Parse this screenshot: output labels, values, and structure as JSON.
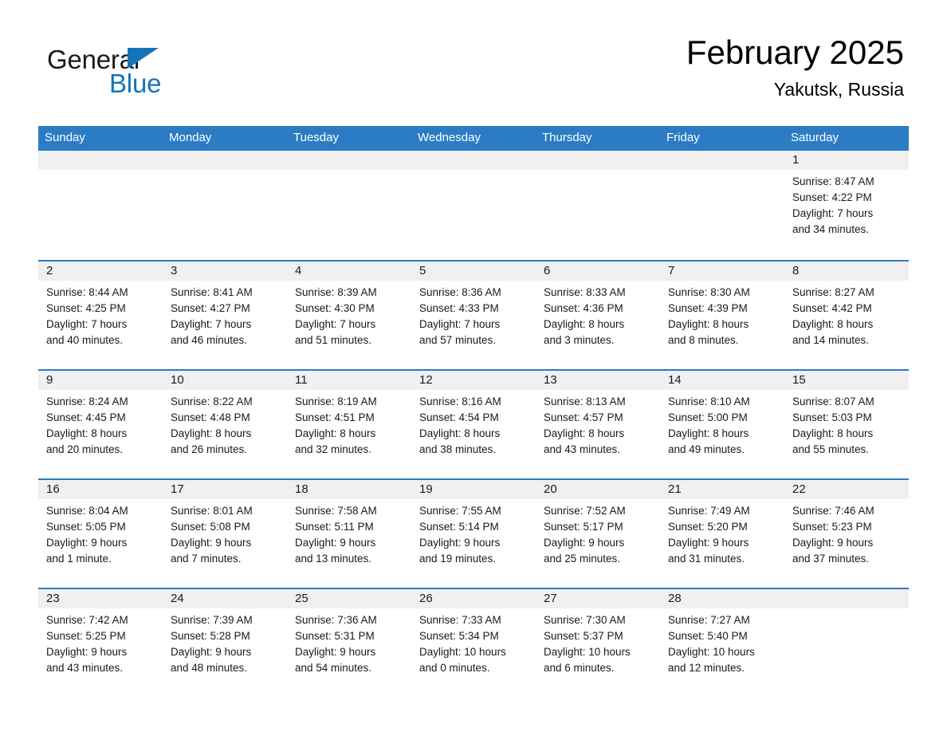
{
  "logo": {
    "word1": "General",
    "word2": "Blue",
    "triangle_color": "#1573b9",
    "text_color": "#1a1a1a"
  },
  "header": {
    "title": "February 2025",
    "location": "Yakutsk, Russia",
    "accent_color": "#2b7cc4"
  },
  "weekdays": [
    "Sunday",
    "Monday",
    "Tuesday",
    "Wednesday",
    "Thursday",
    "Friday",
    "Saturday"
  ],
  "weeks": [
    {
      "days": [
        {
          "num": "",
          "sunrise": "",
          "sunset": "",
          "daylight1": "",
          "daylight2": ""
        },
        {
          "num": "",
          "sunrise": "",
          "sunset": "",
          "daylight1": "",
          "daylight2": ""
        },
        {
          "num": "",
          "sunrise": "",
          "sunset": "",
          "daylight1": "",
          "daylight2": ""
        },
        {
          "num": "",
          "sunrise": "",
          "sunset": "",
          "daylight1": "",
          "daylight2": ""
        },
        {
          "num": "",
          "sunrise": "",
          "sunset": "",
          "daylight1": "",
          "daylight2": ""
        },
        {
          "num": "",
          "sunrise": "",
          "sunset": "",
          "daylight1": "",
          "daylight2": ""
        },
        {
          "num": "1",
          "sunrise": "Sunrise: 8:47 AM",
          "sunset": "Sunset: 4:22 PM",
          "daylight1": "Daylight: 7 hours",
          "daylight2": "and 34 minutes."
        }
      ]
    },
    {
      "days": [
        {
          "num": "2",
          "sunrise": "Sunrise: 8:44 AM",
          "sunset": "Sunset: 4:25 PM",
          "daylight1": "Daylight: 7 hours",
          "daylight2": "and 40 minutes."
        },
        {
          "num": "3",
          "sunrise": "Sunrise: 8:41 AM",
          "sunset": "Sunset: 4:27 PM",
          "daylight1": "Daylight: 7 hours",
          "daylight2": "and 46 minutes."
        },
        {
          "num": "4",
          "sunrise": "Sunrise: 8:39 AM",
          "sunset": "Sunset: 4:30 PM",
          "daylight1": "Daylight: 7 hours",
          "daylight2": "and 51 minutes."
        },
        {
          "num": "5",
          "sunrise": "Sunrise: 8:36 AM",
          "sunset": "Sunset: 4:33 PM",
          "daylight1": "Daylight: 7 hours",
          "daylight2": "and 57 minutes."
        },
        {
          "num": "6",
          "sunrise": "Sunrise: 8:33 AM",
          "sunset": "Sunset: 4:36 PM",
          "daylight1": "Daylight: 8 hours",
          "daylight2": "and 3 minutes."
        },
        {
          "num": "7",
          "sunrise": "Sunrise: 8:30 AM",
          "sunset": "Sunset: 4:39 PM",
          "daylight1": "Daylight: 8 hours",
          "daylight2": "and 8 minutes."
        },
        {
          "num": "8",
          "sunrise": "Sunrise: 8:27 AM",
          "sunset": "Sunset: 4:42 PM",
          "daylight1": "Daylight: 8 hours",
          "daylight2": "and 14 minutes."
        }
      ]
    },
    {
      "days": [
        {
          "num": "9",
          "sunrise": "Sunrise: 8:24 AM",
          "sunset": "Sunset: 4:45 PM",
          "daylight1": "Daylight: 8 hours",
          "daylight2": "and 20 minutes."
        },
        {
          "num": "10",
          "sunrise": "Sunrise: 8:22 AM",
          "sunset": "Sunset: 4:48 PM",
          "daylight1": "Daylight: 8 hours",
          "daylight2": "and 26 minutes."
        },
        {
          "num": "11",
          "sunrise": "Sunrise: 8:19 AM",
          "sunset": "Sunset: 4:51 PM",
          "daylight1": "Daylight: 8 hours",
          "daylight2": "and 32 minutes."
        },
        {
          "num": "12",
          "sunrise": "Sunrise: 8:16 AM",
          "sunset": "Sunset: 4:54 PM",
          "daylight1": "Daylight: 8 hours",
          "daylight2": "and 38 minutes."
        },
        {
          "num": "13",
          "sunrise": "Sunrise: 8:13 AM",
          "sunset": "Sunset: 4:57 PM",
          "daylight1": "Daylight: 8 hours",
          "daylight2": "and 43 minutes."
        },
        {
          "num": "14",
          "sunrise": "Sunrise: 8:10 AM",
          "sunset": "Sunset: 5:00 PM",
          "daylight1": "Daylight: 8 hours",
          "daylight2": "and 49 minutes."
        },
        {
          "num": "15",
          "sunrise": "Sunrise: 8:07 AM",
          "sunset": "Sunset: 5:03 PM",
          "daylight1": "Daylight: 8 hours",
          "daylight2": "and 55 minutes."
        }
      ]
    },
    {
      "days": [
        {
          "num": "16",
          "sunrise": "Sunrise: 8:04 AM",
          "sunset": "Sunset: 5:05 PM",
          "daylight1": "Daylight: 9 hours",
          "daylight2": "and 1 minute."
        },
        {
          "num": "17",
          "sunrise": "Sunrise: 8:01 AM",
          "sunset": "Sunset: 5:08 PM",
          "daylight1": "Daylight: 9 hours",
          "daylight2": "and 7 minutes."
        },
        {
          "num": "18",
          "sunrise": "Sunrise: 7:58 AM",
          "sunset": "Sunset: 5:11 PM",
          "daylight1": "Daylight: 9 hours",
          "daylight2": "and 13 minutes."
        },
        {
          "num": "19",
          "sunrise": "Sunrise: 7:55 AM",
          "sunset": "Sunset: 5:14 PM",
          "daylight1": "Daylight: 9 hours",
          "daylight2": "and 19 minutes."
        },
        {
          "num": "20",
          "sunrise": "Sunrise: 7:52 AM",
          "sunset": "Sunset: 5:17 PM",
          "daylight1": "Daylight: 9 hours",
          "daylight2": "and 25 minutes."
        },
        {
          "num": "21",
          "sunrise": "Sunrise: 7:49 AM",
          "sunset": "Sunset: 5:20 PM",
          "daylight1": "Daylight: 9 hours",
          "daylight2": "and 31 minutes."
        },
        {
          "num": "22",
          "sunrise": "Sunrise: 7:46 AM",
          "sunset": "Sunset: 5:23 PM",
          "daylight1": "Daylight: 9 hours",
          "daylight2": "and 37 minutes."
        }
      ]
    },
    {
      "days": [
        {
          "num": "23",
          "sunrise": "Sunrise: 7:42 AM",
          "sunset": "Sunset: 5:25 PM",
          "daylight1": "Daylight: 9 hours",
          "daylight2": "and 43 minutes."
        },
        {
          "num": "24",
          "sunrise": "Sunrise: 7:39 AM",
          "sunset": "Sunset: 5:28 PM",
          "daylight1": "Daylight: 9 hours",
          "daylight2": "and 48 minutes."
        },
        {
          "num": "25",
          "sunrise": "Sunrise: 7:36 AM",
          "sunset": "Sunset: 5:31 PM",
          "daylight1": "Daylight: 9 hours",
          "daylight2": "and 54 minutes."
        },
        {
          "num": "26",
          "sunrise": "Sunrise: 7:33 AM",
          "sunset": "Sunset: 5:34 PM",
          "daylight1": "Daylight: 10 hours",
          "daylight2": "and 0 minutes."
        },
        {
          "num": "27",
          "sunrise": "Sunrise: 7:30 AM",
          "sunset": "Sunset: 5:37 PM",
          "daylight1": "Daylight: 10 hours",
          "daylight2": "and 6 minutes."
        },
        {
          "num": "28",
          "sunrise": "Sunrise: 7:27 AM",
          "sunset": "Sunset: 5:40 PM",
          "daylight1": "Daylight: 10 hours",
          "daylight2": "and 12 minutes."
        },
        {
          "num": "",
          "sunrise": "",
          "sunset": "",
          "daylight1": "",
          "daylight2": ""
        }
      ]
    }
  ]
}
